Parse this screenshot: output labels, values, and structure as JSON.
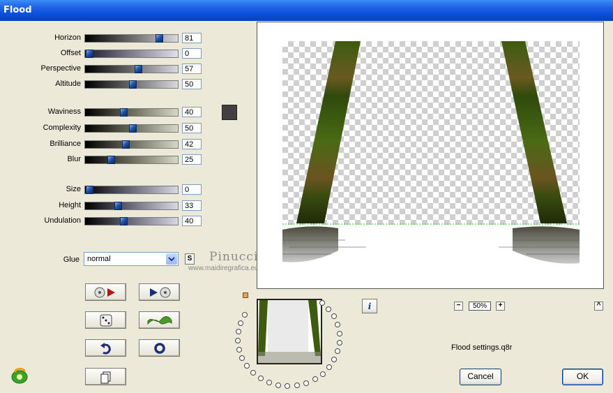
{
  "window": {
    "title": "Flood"
  },
  "sliders": [
    {
      "label": "Horizon",
      "value": "81",
      "level": 81
    },
    {
      "label": "Offset",
      "value": "0",
      "level": 0
    },
    {
      "label": "Perspective",
      "value": "57",
      "level": 57
    },
    {
      "label": "Altitude",
      "value": "50",
      "level": 50
    },
    {
      "label": "Waviness",
      "value": "40",
      "level": 40
    },
    {
      "label": "Complexity",
      "value": "50",
      "level": 50
    },
    {
      "label": "Brilliance",
      "value": "42",
      "level": 42
    },
    {
      "label": "Blur",
      "value": "25",
      "level": 25
    },
    {
      "label": "Size",
      "value": "0",
      "level": 0
    },
    {
      "label": "Height",
      "value": "33",
      "level": 33
    },
    {
      "label": "Undulation",
      "value": "40",
      "level": 40
    }
  ],
  "glue": {
    "label": "Glue",
    "value": "normal"
  },
  "watermark": {
    "name": "Pinuccia",
    "url": "www.maidiregrafica.eu"
  },
  "zoom": {
    "value": "50%",
    "minus": "−",
    "plus": "+"
  },
  "settings_file": "Flood settings.q8r",
  "buttons": {
    "cancel": "Cancel",
    "ok": "OK",
    "info": "i",
    "s": "S",
    "up": "^"
  },
  "colors": {
    "color_swatch": "#404040",
    "titlebar": "#0a4ed8"
  }
}
